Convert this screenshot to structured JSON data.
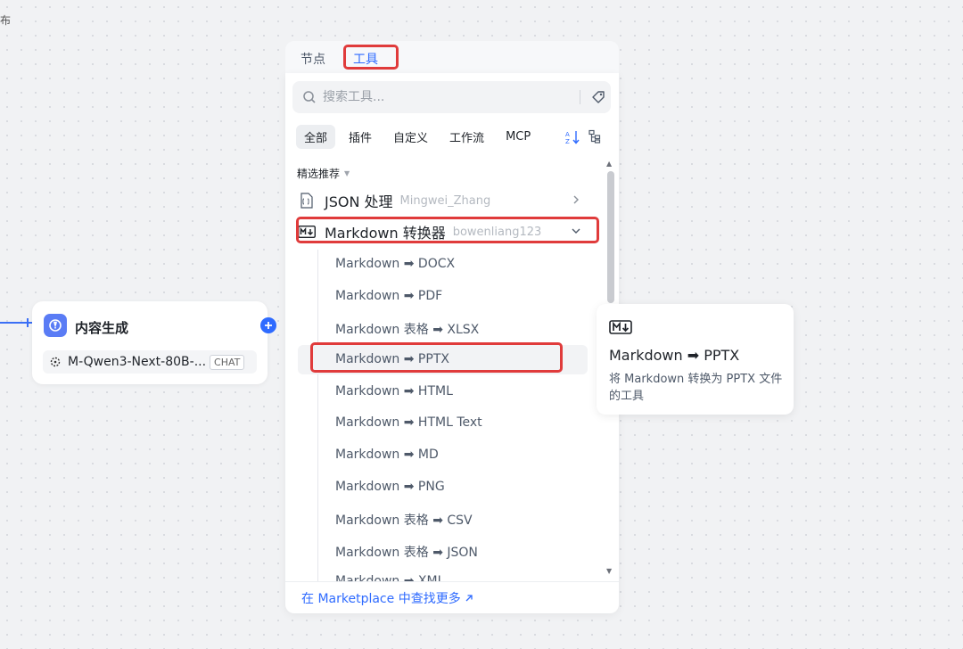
{
  "canvas": {
    "corner_text": "布"
  },
  "node": {
    "title": "内容生成",
    "model": "M-Qwen3-Next-80B-...",
    "model_badge": "CHAT"
  },
  "panel": {
    "tabs": [
      {
        "label": "节点"
      },
      {
        "label": "工具"
      }
    ],
    "search": {
      "placeholder": "搜索工具...",
      "value": ""
    },
    "filters": [
      "全部",
      "插件",
      "自定义",
      "工作流",
      "MCP"
    ],
    "section_label": "精选推荐",
    "tools": [
      {
        "name": "JSON 处理",
        "author": "Mingwei_Zhang"
      },
      {
        "name": "Markdown 转换器",
        "author": "bowenliang123"
      }
    ],
    "sub_items": [
      "Markdown ➡ DOCX",
      "Markdown ➡ PDF",
      "Markdown 表格 ➡ XLSX",
      "Markdown ➡ PPTX",
      "Markdown ➡ HTML",
      "Markdown ➡ HTML Text",
      "Markdown ➡ MD",
      "Markdown ➡ PNG",
      "Markdown 表格 ➡ CSV",
      "Markdown 表格 ➡ JSON",
      "Markdown ➡ XML"
    ],
    "footer_link": "在 Marketplace 中查找更多"
  },
  "tooltip": {
    "title": "Markdown ➡ PPTX",
    "description": "将 Markdown 转换为 PPTX 文件的工具"
  },
  "colors": {
    "accent": "#2f6bff",
    "highlight": "#e03b3b",
    "node_icon": "#5a7cf5"
  }
}
